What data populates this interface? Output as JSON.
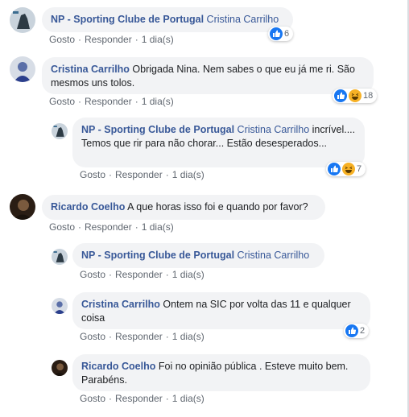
{
  "labels": {
    "like": "Gosto",
    "reply": "Responder",
    "dot": "·"
  },
  "comments": [
    {
      "author": "NP - Sporting Clube de Portugal",
      "tag": "Cristina Carrilho",
      "text": "",
      "time": "1 dia(s)",
      "reactions": {
        "icons": [
          "like"
        ],
        "count": "6"
      }
    },
    {
      "author": "Cristina Carrilho",
      "tag": "",
      "text": "Obrigada Nina. Nem sabes o que eu já me ri. São mesmos uns tolos.",
      "time": "1 dia(s)",
      "reactions": {
        "icons": [
          "like",
          "haha"
        ],
        "count": "18"
      }
    },
    {
      "author": "NP - Sporting Clube de Portugal",
      "tag": "Cristina Carrilho",
      "text": "incrível.... Temos que rir para não chorar... Estão desesperados...",
      "time": "1 dia(s)",
      "reactions": {
        "icons": [
          "like",
          "haha"
        ],
        "count": "7"
      }
    },
    {
      "author": "Ricardo Coelho",
      "tag": "",
      "text": "A que horas isso foi e quando por favor?",
      "time": "1 dia(s)",
      "reactions": null
    },
    {
      "author": "NP - Sporting Clube de Portugal",
      "tag": "Cristina Carrilho",
      "text": "",
      "time": "1 dia(s)",
      "reactions": null
    },
    {
      "author": "Cristina Carrilho",
      "tag": "",
      "text": "Ontem na SIC por volta das 11 e qualquer coisa",
      "time": "1 dia(s)",
      "reactions": {
        "icons": [
          "like"
        ],
        "count": "2"
      }
    },
    {
      "author": "Ricardo Coelho",
      "tag": "",
      "text": "Foi no opinião pública . Esteve muito bem. Parabéns.",
      "time": "1 dia(s)",
      "reactions": null
    }
  ],
  "colors": {
    "link": "#385898",
    "bubble": "#f2f3f5",
    "meta": "#606770",
    "like_blue": "#1877f2",
    "haha_yellow": "#f7b125"
  }
}
